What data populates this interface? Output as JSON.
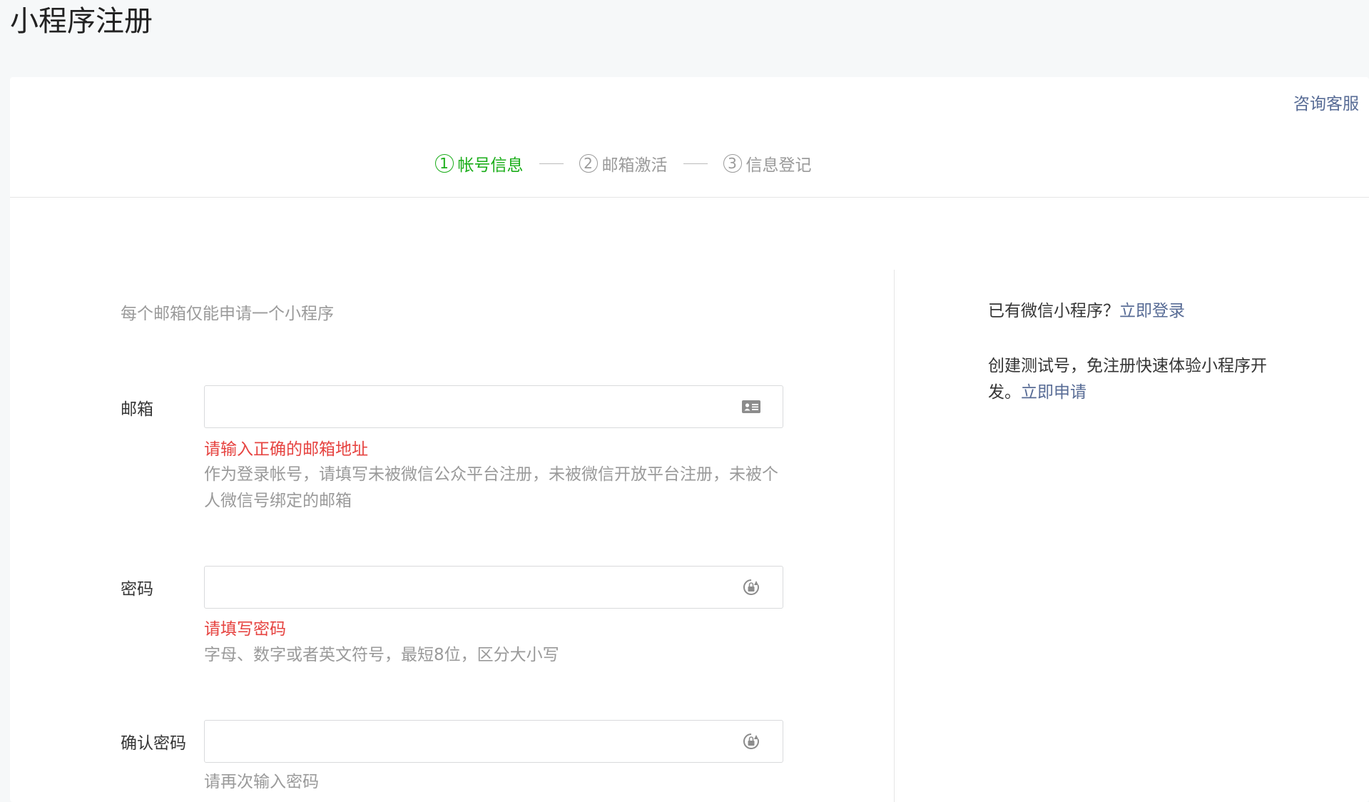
{
  "page": {
    "title": "小程序注册"
  },
  "header": {
    "consult_link": "咨询客服"
  },
  "steps": [
    {
      "num": "1",
      "label": "帐号信息",
      "active": true
    },
    {
      "num": "2",
      "label": "邮箱激活",
      "active": false
    },
    {
      "num": "3",
      "label": "信息登记",
      "active": false
    }
  ],
  "form": {
    "notice": "每个邮箱仅能申请一个小程序",
    "email": {
      "label": "邮箱",
      "value": "",
      "error": "请输入正确的邮箱地址",
      "hint": "作为登录帐号，请填写未被微信公众平台注册，未被微信开放平台注册，未被个人微信号绑定的邮箱",
      "icon": "id-card-icon"
    },
    "password": {
      "label": "密码",
      "value": "",
      "error": "请填写密码",
      "hint": "字母、数字或者英文符号，最短8位，区分大小写",
      "icon": "password-lock-icon"
    },
    "confirm_password": {
      "label": "确认密码",
      "value": "",
      "hint": "请再次输入密码",
      "icon": "password-lock-icon"
    }
  },
  "side": {
    "login_prompt": "已有微信小程序？",
    "login_link": "立即登录",
    "test_prompt": "创建测试号，免注册快速体验小程序开发。",
    "test_link": "立即申请"
  },
  "colors": {
    "accent_green": "#1aad19",
    "link_blue": "#576b95",
    "error_red": "#e64340",
    "hint_gray": "#9a9a9a"
  }
}
